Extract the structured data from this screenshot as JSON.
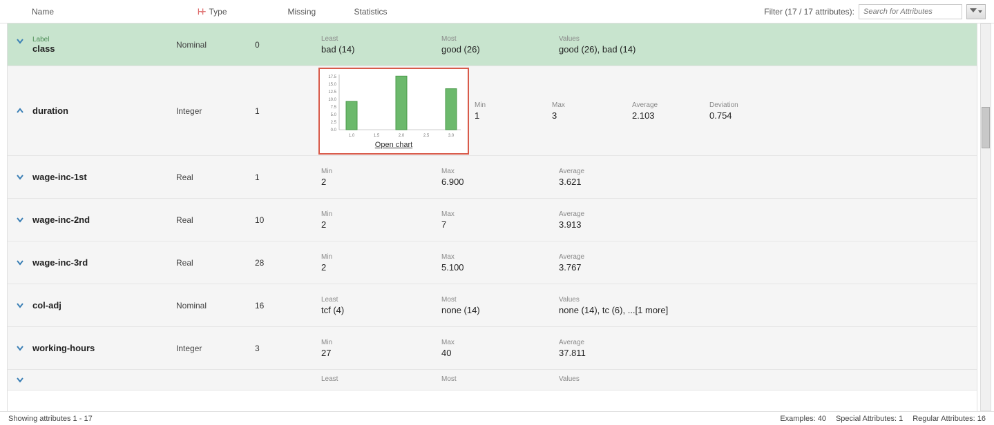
{
  "header": {
    "name": "Name",
    "type": "Type",
    "missing": "Missing",
    "statistics": "Statistics",
    "filter_label": "Filter (17 / 17 attributes):",
    "search_placeholder": "Search for Attributes"
  },
  "rows": [
    {
      "special": true,
      "tag": "Label",
      "name": "class",
      "type": "Nominal",
      "missing": "0",
      "stats": [
        {
          "label": "Least",
          "value": "bad (14)"
        },
        {
          "label": "Most",
          "value": "good (26)"
        },
        {
          "label": "Values",
          "value": "good (26), bad (14)"
        }
      ]
    },
    {
      "expanded": true,
      "name": "duration",
      "type": "Integer",
      "missing": "1",
      "open_chart": "Open chart",
      "stats": [
        {
          "label": "Min",
          "value": "1"
        },
        {
          "label": "Max",
          "value": "3"
        },
        {
          "label": "Average",
          "value": "2.103"
        },
        {
          "label": "Deviation",
          "value": "0.754"
        }
      ]
    },
    {
      "name": "wage-inc-1st",
      "type": "Real",
      "missing": "1",
      "stats": [
        {
          "label": "Min",
          "value": "2"
        },
        {
          "label": "Max",
          "value": "6.900"
        },
        {
          "label": "Average",
          "value": "3.621"
        }
      ]
    },
    {
      "name": "wage-inc-2nd",
      "type": "Real",
      "missing": "10",
      "stats": [
        {
          "label": "Min",
          "value": "2"
        },
        {
          "label": "Max",
          "value": "7"
        },
        {
          "label": "Average",
          "value": "3.913"
        }
      ]
    },
    {
      "name": "wage-inc-3rd",
      "type": "Real",
      "missing": "28",
      "stats": [
        {
          "label": "Min",
          "value": "2"
        },
        {
          "label": "Max",
          "value": "5.100"
        },
        {
          "label": "Average",
          "value": "3.767"
        }
      ]
    },
    {
      "name": "col-adj",
      "type": "Nominal",
      "missing": "16",
      "stats": [
        {
          "label": "Least",
          "value": "tcf (4)"
        },
        {
          "label": "Most",
          "value": "none (14)"
        },
        {
          "label": "Values",
          "value": "none (14), tc (6), ...[1 more]"
        }
      ]
    },
    {
      "name": "working-hours",
      "type": "Integer",
      "missing": "3",
      "stats": [
        {
          "label": "Min",
          "value": "27"
        },
        {
          "label": "Max",
          "value": "40"
        },
        {
          "label": "Average",
          "value": "37.811"
        }
      ]
    },
    {
      "name": "",
      "type": "",
      "missing": "",
      "stats": [
        {
          "label": "Least",
          "value": ""
        },
        {
          "label": "Most",
          "value": ""
        },
        {
          "label": "Values",
          "value": ""
        }
      ]
    }
  ],
  "chart_data": {
    "type": "bar",
    "categories": [
      "1.0",
      "1.5",
      "2.0",
      "2.5",
      "3.0"
    ],
    "values": [
      9,
      0,
      17,
      0,
      13
    ],
    "y_ticks": [
      "0.0",
      "2.5",
      "5.0",
      "7.5",
      "10.0",
      "12.5",
      "15.0",
      "17.5"
    ],
    "ylim": [
      0,
      17.5
    ]
  },
  "footer": {
    "left": "Showing attributes 1 - 17",
    "examples": "Examples: 40",
    "special": "Special Attributes: 1",
    "regular": "Regular Attributes: 16"
  }
}
